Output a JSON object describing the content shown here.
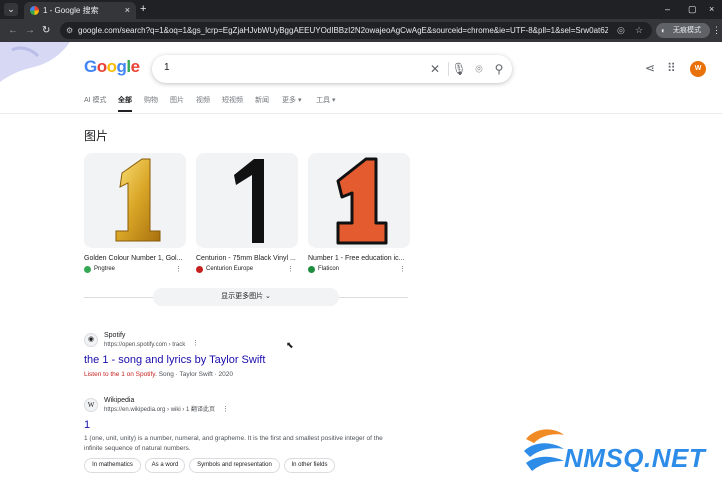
{
  "browser": {
    "tab_menu_icon": "chevron-down-icon",
    "tab_title": "1 - Google 搜索",
    "tab_close": "×",
    "new_tab": "+",
    "window_controls": [
      "–",
      "▢",
      "×"
    ],
    "url": "google.com/search?q=1&oq=1&gs_lcrp=EgZjaHJvbWUyBggAEEUYOdIBBzI2N2owajeoAgCwAgE&sourceid=chrome&ie=UTF-8&pll=1&sel=Srw0at6ZGJ2N4-...",
    "incognito_label": "无痕模式",
    "menu_icon": "⋮"
  },
  "search": {
    "query": "1",
    "tabs": [
      "AI 模式",
      "全部",
      "购物",
      "图片",
      "视频",
      "短视频",
      "新闻",
      "更多 ▾",
      "工具 ▾"
    ],
    "active_tab": "全部",
    "avatar_letter": "W"
  },
  "images": {
    "heading": "图片",
    "cards": [
      {
        "caption": "Golden Colour Number 1, Gol...",
        "source": "Pngtree",
        "source_color": "#34a853"
      },
      {
        "caption": "Centurion - 75mm Black Vinyl ...",
        "source": "Centurion Europe",
        "source_color": "#c5221f"
      },
      {
        "caption": "Number 1 - Free education ic...",
        "source": "Flaticon",
        "source_color": "#1e8e3e"
      }
    ],
    "show_more": "显示更多图片 ⌄"
  },
  "results": [
    {
      "site_name": "Spotify",
      "site_url": "https://open.spotify.com › track",
      "title": "the 1 - song and lyrics by Taylor Swift",
      "snippet_em": "Listen to the 1 on Spotify",
      "snippet_rest": ". Song · Taylor Swift · 2020"
    },
    {
      "site_name": "Wikipedia",
      "site_url": "https://en.wikipedia.org › wiki › 1 翻译此页",
      "title": "1",
      "snippet_line1": "1 (one, unit, unity) is a number, numeral, and grapheme. It is the first and smallest positive integer of the",
      "snippet_line2": "infinite sequence of natural numbers."
    }
  ],
  "chips": [
    "In mathematics",
    "As a word",
    "Symbols and representation",
    "In other fields"
  ],
  "watermark": {
    "text": "NMSQ.NET",
    "color": "#2d8ce8"
  }
}
